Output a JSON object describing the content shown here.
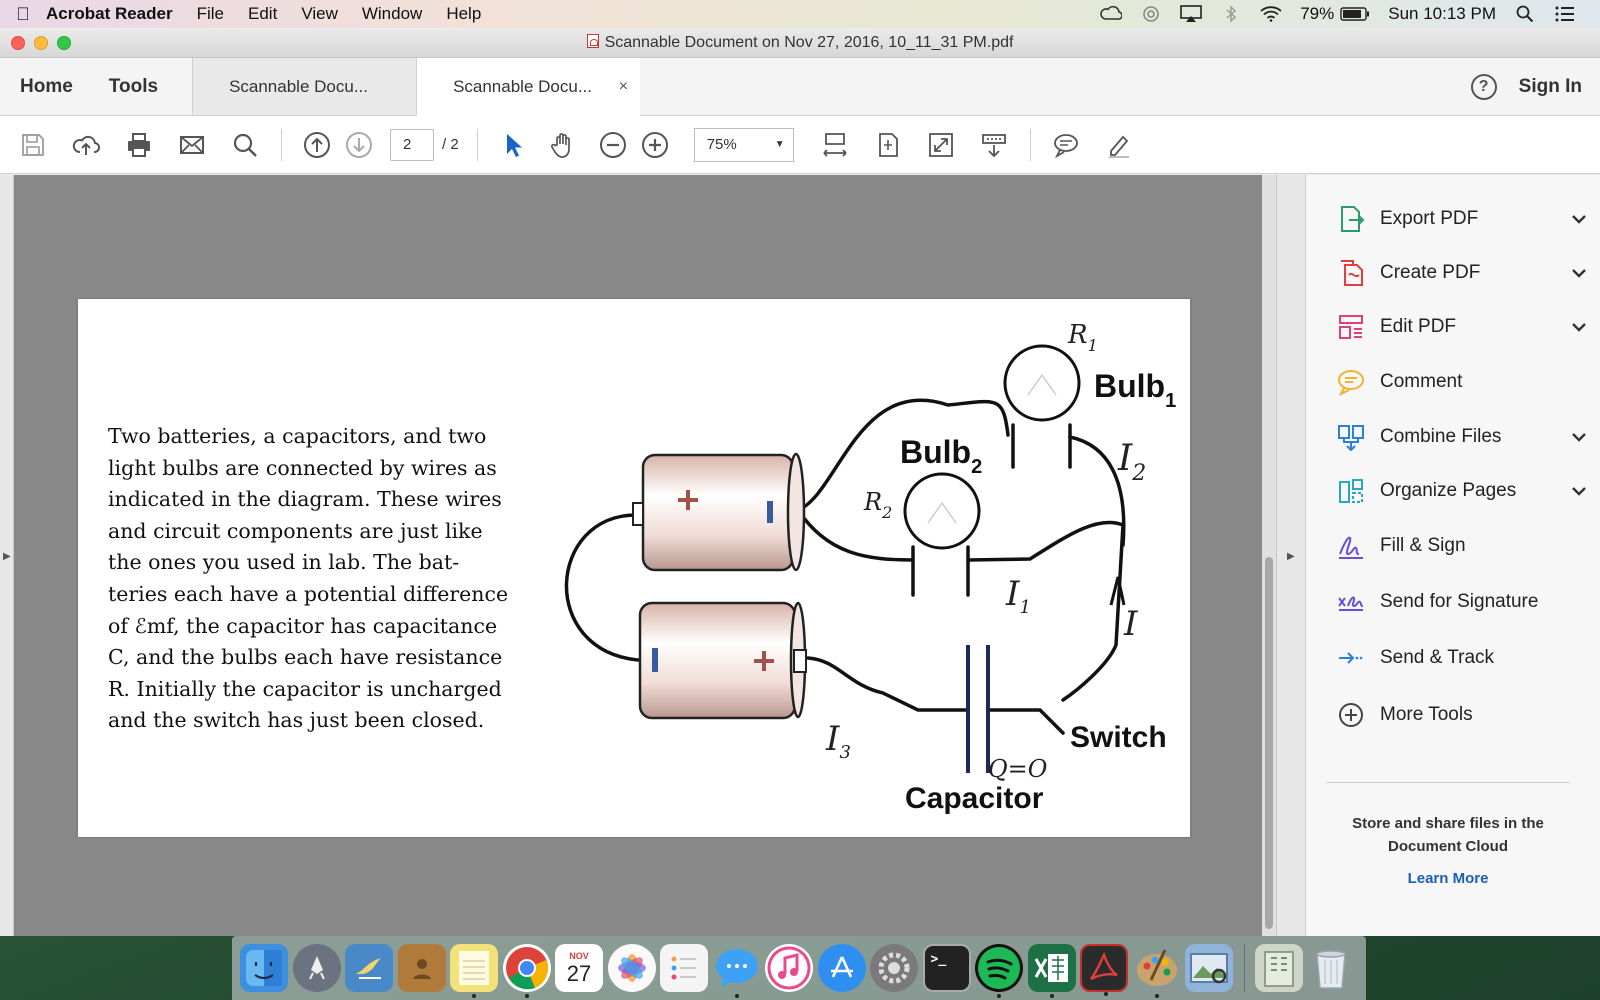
{
  "menubar": {
    "app_name": "Acrobat Reader",
    "menus": [
      "File",
      "Edit",
      "View",
      "Window",
      "Help"
    ],
    "battery": "79%",
    "clock": "Sun 10:13 PM"
  },
  "window": {
    "title": "Scannable Document on Nov 27, 2016, 10_11_31 PM.pdf"
  },
  "tabbar": {
    "home": "Home",
    "tools": "Tools",
    "tabs": [
      {
        "label": "Scannable Docu..."
      },
      {
        "label": "Scannable Docu..."
      }
    ],
    "close": "×",
    "help": "?",
    "sign_in": "Sign In"
  },
  "toolbar": {
    "current_page": "2",
    "total_pages": "/ 2",
    "zoom": "75%"
  },
  "document": {
    "paragraph_lines": [
      "Two batteries, a capacitors, and two",
      "light bulbs are connected by wires as",
      "indicated in the diagram. These wires",
      "and circuit components are just like",
      "the ones you used in lab.  The bat-",
      "teries each have a potential difference",
      "of ℰmf, the capacitor has capacitance",
      "C, and the bulbs each have resistance",
      "R. Initially the capacitor is uncharged",
      "and the switch has just been closed."
    ],
    "diagram": {
      "bulb1": "Bulb",
      "bulb1_sub": "1",
      "bulb2": "Bulb",
      "bulb2_sub": "2",
      "switch": "Switch",
      "capacitor": "Capacitor",
      "r1": "R",
      "r1_sub": "1",
      "r2": "R",
      "r2_sub": "2",
      "i1": "I",
      "i1_sub": "1",
      "i2": "I",
      "i2_sub": "2",
      "i3": "I",
      "i3_sub": "3",
      "i": "I",
      "q": "Q=O"
    }
  },
  "tools_pane": {
    "items": [
      {
        "label": "Export PDF",
        "icon": "export-pdf-icon",
        "chevron": true,
        "color": "#2a9d6a"
      },
      {
        "label": "Create PDF",
        "icon": "create-pdf-icon",
        "chevron": true,
        "color": "#e0403c"
      },
      {
        "label": "Edit PDF",
        "icon": "edit-pdf-icon",
        "chevron": true,
        "color": "#e0407a"
      },
      {
        "label": "Comment",
        "icon": "comment-icon",
        "chevron": false,
        "color": "#f2b22e"
      },
      {
        "label": "Combine Files",
        "icon": "combine-files-icon",
        "chevron": true,
        "color": "#2a7fd6"
      },
      {
        "label": "Organize Pages",
        "icon": "organize-pages-icon",
        "chevron": true,
        "color": "#27a6c8"
      },
      {
        "label": "Fill & Sign",
        "icon": "fill-sign-icon",
        "chevron": false,
        "color": "#6a4fd6"
      },
      {
        "label": "Send for Signature",
        "icon": "send-signature-icon",
        "chevron": false,
        "color": "#6a4fd6"
      },
      {
        "label": "Send & Track",
        "icon": "send-track-icon",
        "chevron": false,
        "color": "#2a7fd6"
      },
      {
        "label": "More Tools",
        "icon": "more-tools-icon",
        "chevron": false,
        "color": "#444444"
      }
    ],
    "cloud_text_1": "Store and share files in the",
    "cloud_text_2": "Document Cloud",
    "learn_more": "Learn More"
  },
  "dock": {
    "calendar_month": "NOV",
    "calendar_day": "27",
    "apps": [
      {
        "name": "finder-icon",
        "color": "#3d8fe0"
      },
      {
        "name": "launchpad-icon",
        "color": "#6b7280"
      },
      {
        "name": "mail-bird-icon",
        "color": "#4a89c8"
      },
      {
        "name": "contacts-icon",
        "color": "#b07a3a"
      },
      {
        "name": "notes-icon",
        "color": "#f3e27a"
      },
      {
        "name": "chrome-icon",
        "color": "#d93b30"
      },
      {
        "name": "calendar-icon",
        "color": "#ffffff"
      },
      {
        "name": "photos-icon",
        "color": "#f0a24a"
      },
      {
        "name": "reminders-icon",
        "color": "#f4f4f4"
      },
      {
        "name": "messages-icon",
        "color": "#3da2f5"
      },
      {
        "name": "itunes-icon",
        "color": "#e84a8b"
      },
      {
        "name": "app-store-icon",
        "color": "#2f8ff0"
      },
      {
        "name": "system-preferences-icon",
        "color": "#7a7a7a"
      },
      {
        "name": "terminal-icon",
        "color": "#222222"
      },
      {
        "name": "spotify-icon",
        "color": "#1db954"
      },
      {
        "name": "excel-icon",
        "color": "#1e7145"
      },
      {
        "name": "acrobat-icon",
        "color": "#2b2b2b"
      },
      {
        "name": "art-palette-icon",
        "color": "#c9a36b"
      },
      {
        "name": "preview-icon",
        "color": "#8fb3d9"
      },
      {
        "name": "archive-icon",
        "color": "#cfd6c8"
      },
      {
        "name": "trash-icon",
        "color": "#d8dde2"
      }
    ]
  }
}
